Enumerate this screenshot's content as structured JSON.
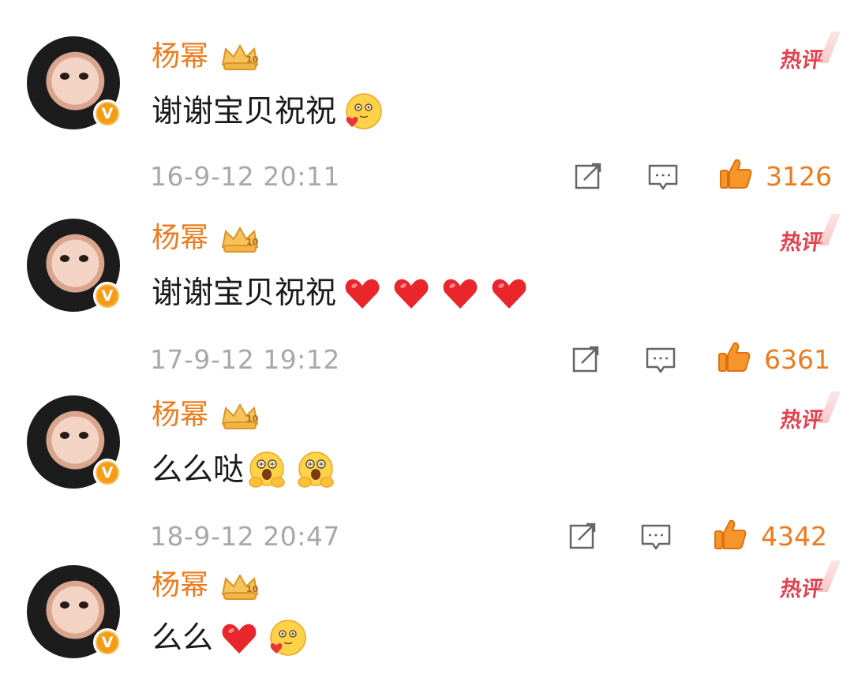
{
  "comments": [
    {
      "username": "杨幂",
      "hot_label": "热评",
      "text": "谢谢宝贝祝祝",
      "emojis": [
        "blush-heart-emoji"
      ],
      "timestamp": "16-9-12 20:11",
      "likes": "3126"
    },
    {
      "username": "杨幂",
      "hot_label": "热评",
      "text": "谢谢宝贝祝祝",
      "emojis": [
        "red-heart-emoji",
        "red-heart-emoji",
        "red-heart-emoji",
        "red-heart-emoji"
      ],
      "timestamp": "17-9-12 19:12",
      "likes": "6361"
    },
    {
      "username": "杨幂",
      "hot_label": "热评",
      "text": "么么哒",
      "emojis": [
        "hug-emoji",
        "hug-emoji"
      ],
      "timestamp": "18-9-12 20:47",
      "likes": "4342"
    },
    {
      "username": "杨幂",
      "hot_label": "热评",
      "text": "么么",
      "emojis": [
        "red-heart-emoji",
        "blush-heart-emoji"
      ],
      "timestamp": "",
      "likes": ""
    }
  ],
  "badges": {
    "verified_badge": "V",
    "crown_label": "10"
  },
  "colors": {
    "username": "#eb7c1e",
    "hot_label": "#e2424e",
    "timestamp": "#a8a8a8",
    "like": "#eb7c1e",
    "verified": "#f59b16"
  }
}
